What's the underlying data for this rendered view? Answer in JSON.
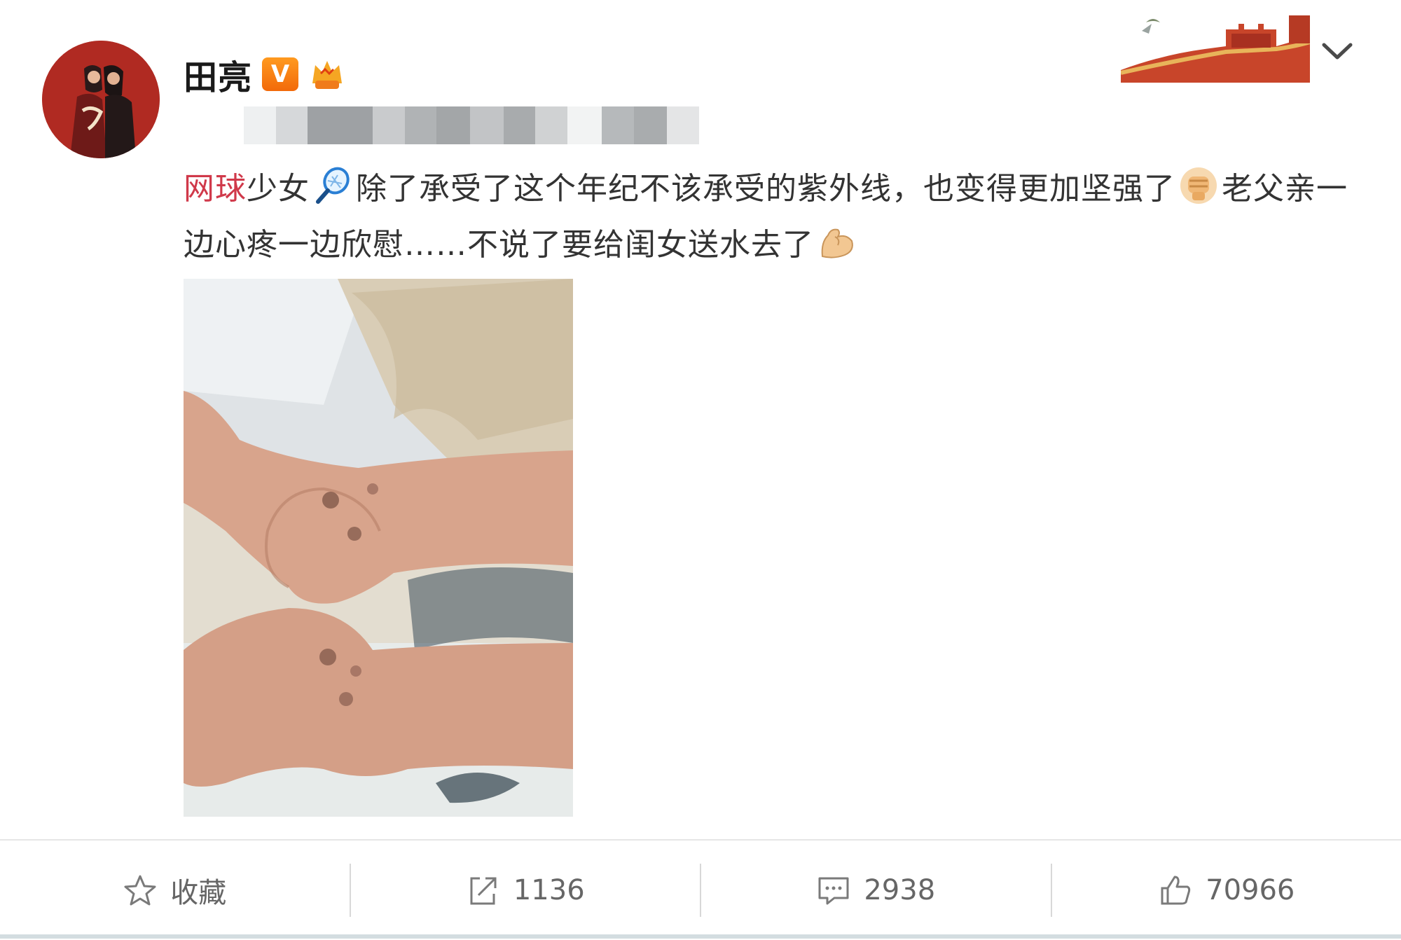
{
  "user": {
    "name": "田亮",
    "verified_badge": "V",
    "accent_color": "#f26a0a"
  },
  "post": {
    "topic_link": "网球",
    "text_part1": "少女",
    "text_part2": "除了承受了这个年纪不该承受的紫外线，也变得更加坚强了",
    "text_part3": "老父亲一边心疼一边欣慰……不说了要给闺女送水去了",
    "icons": [
      "tennis-racket-icon",
      "fist-icon",
      "flexed-biceps-icon"
    ],
    "topic_color": "#d0394a"
  },
  "actions": {
    "favorite_label": "收藏",
    "repost_count": "1136",
    "comment_count": "2938",
    "like_count": "70966"
  }
}
